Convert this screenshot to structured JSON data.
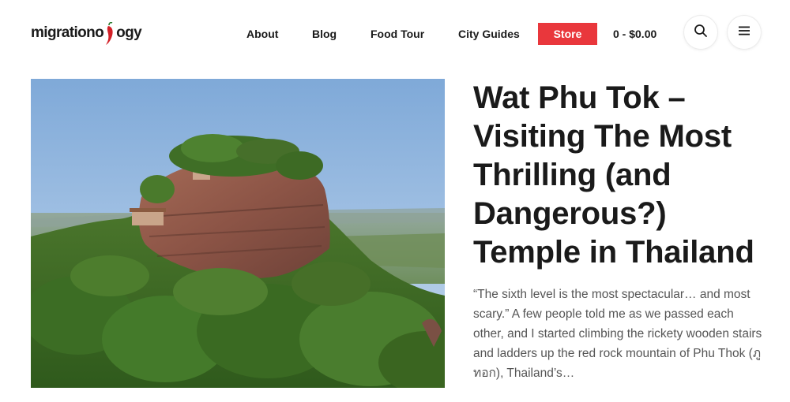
{
  "brand": {
    "logo_text_left": "migrationo",
    "logo_text_right": "ogy"
  },
  "nav": {
    "items": [
      {
        "label": "About"
      },
      {
        "label": "Blog"
      },
      {
        "label": "Food Tour"
      },
      {
        "label": "City Guides"
      }
    ],
    "store_label": "Store",
    "cart_label": "0 - $0.00",
    "search_icon": "search-icon",
    "menu_icon": "hamburger-menu-icon"
  },
  "colors": {
    "accent": "#e9373c",
    "text": "#1a1a1a",
    "muted": "#555555"
  },
  "article": {
    "title": "Wat Phu Tok – Visiting The Most Thrilling (and Dangerous?) Temple in Thailand",
    "excerpt": "“The sixth level is the most spectacular… and most scary.” A few people told me as we passed each other, and I started climbing the rickety wooden stairs and ladders up the red rock mountain of Phu Thok (ภูทอก), Thailand’s…"
  }
}
